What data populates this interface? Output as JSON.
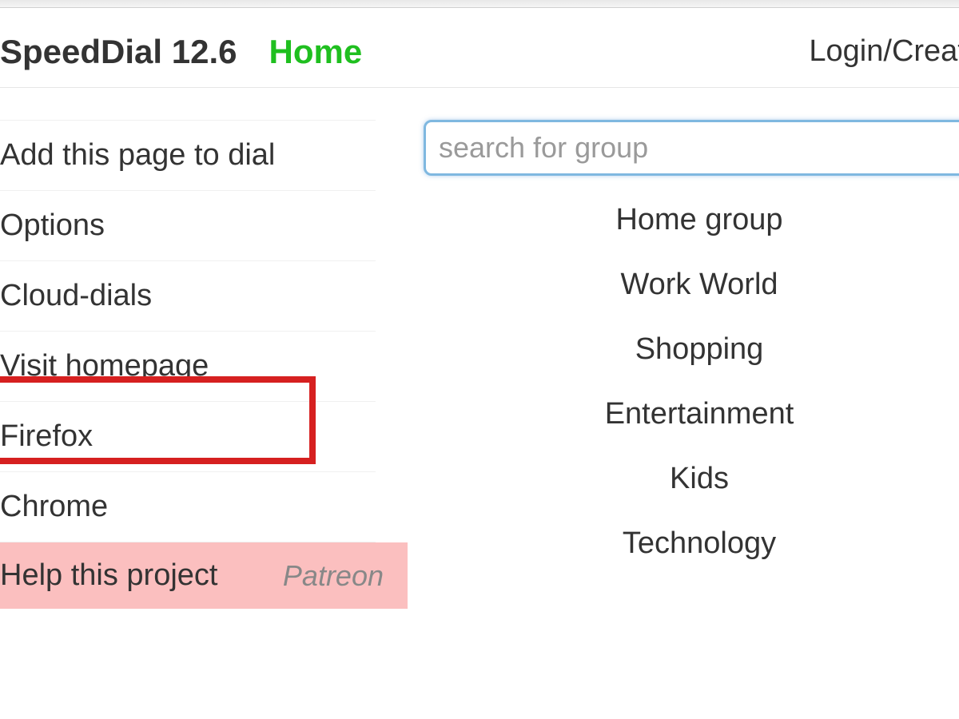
{
  "header": {
    "app_title": "SpeedDial 12.6",
    "home_label": "Home",
    "login_label": "Login/Create"
  },
  "menu": {
    "add_page": "Add this page to dial",
    "options": "Options",
    "cloud_dials": "Cloud-dials",
    "visit_homepage": "Visit homepage",
    "firefox": "Firefox",
    "chrome": "Chrome",
    "help_project": "Help this project",
    "patreon": "Patreon"
  },
  "search": {
    "placeholder": "search for group"
  },
  "groups": [
    "Home group",
    "Work World",
    "Shopping",
    "Entertainment",
    "Kids",
    "Technology"
  ]
}
